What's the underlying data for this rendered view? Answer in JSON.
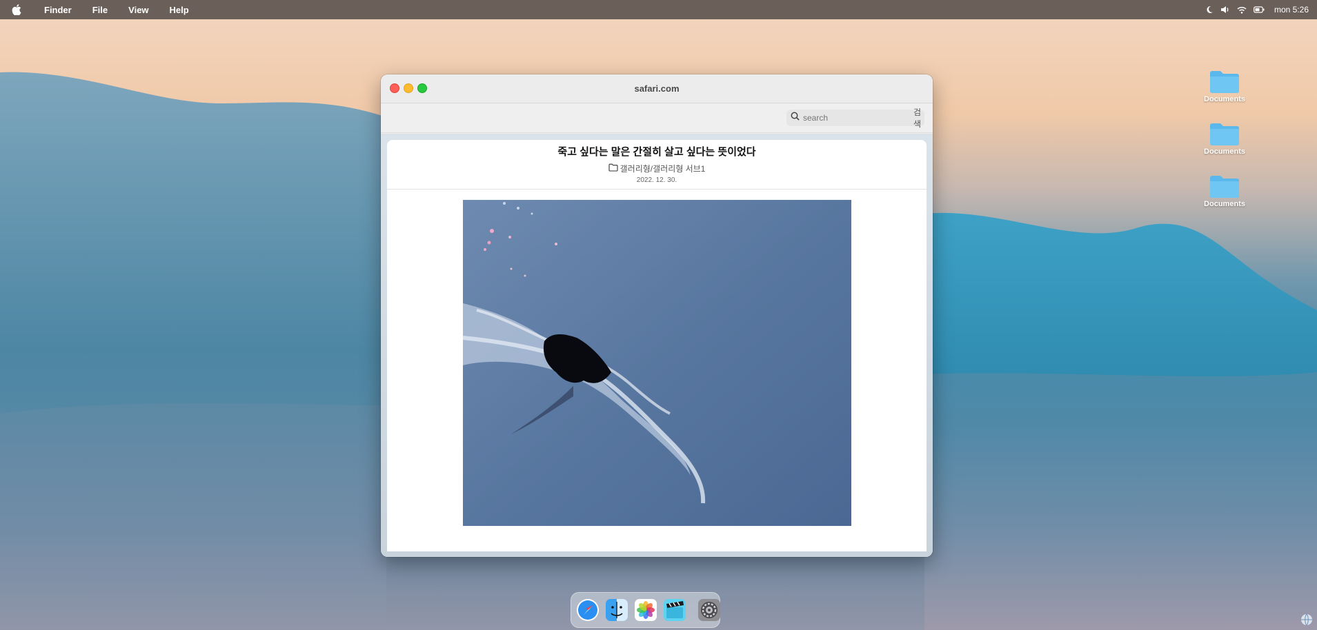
{
  "menubar": {
    "items": [
      "Finder",
      "File",
      "View",
      "Help"
    ],
    "clock": "mon 5:26"
  },
  "desktop": {
    "icons": [
      {
        "label": "Documents"
      },
      {
        "label": "Documents"
      },
      {
        "label": "Documents"
      }
    ]
  },
  "window": {
    "title": "safari.com",
    "search": {
      "placeholder": "search",
      "value": "",
      "button_label": "검색"
    }
  },
  "post": {
    "title": "죽고 싶다는 말은 간절히 살고 싶다는 뜻이었다",
    "category": "갤러리형/갤러리형 서브1",
    "date": "2022. 12. 30."
  },
  "dock": {
    "apps": [
      "safari-icon",
      "finder-icon",
      "photos-icon",
      "imovie-icon",
      "system-preferences-icon"
    ]
  },
  "colors": {
    "close": "#ff5f57",
    "minimize": "#febc2e",
    "maximize": "#28c840",
    "folder": "#5bb8ec"
  }
}
